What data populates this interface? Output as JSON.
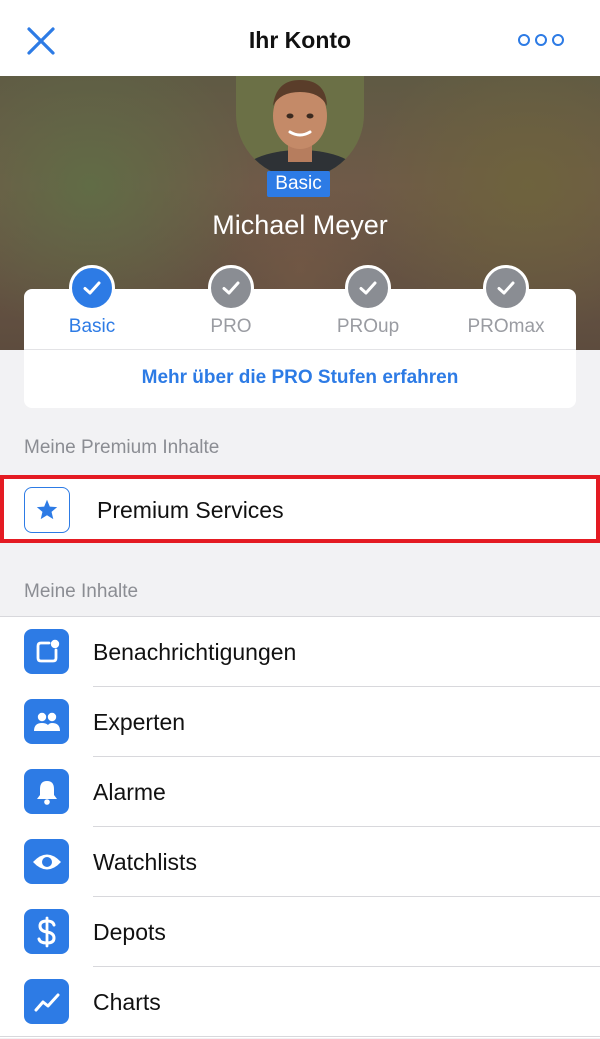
{
  "nav": {
    "title": "Ihr Konto",
    "close_icon": "close-icon",
    "more_icon": "more-icon"
  },
  "profile": {
    "badge": "Basic",
    "name": "Michael Meyer"
  },
  "tiers": {
    "items": [
      {
        "label": "Basic",
        "active": true
      },
      {
        "label": "PRO",
        "active": false
      },
      {
        "label": "PROup",
        "active": false
      },
      {
        "label": "PROmax",
        "active": false
      }
    ],
    "link": "Mehr über die PRO Stufen erfahren"
  },
  "premium": {
    "section_label": "Meine Premium Inhalte",
    "item": {
      "label": "Premium Services",
      "icon": "star-icon"
    }
  },
  "content": {
    "section_label": "Meine Inhalte",
    "items": [
      {
        "label": "Benachrichtigungen",
        "icon": "notification-icon"
      },
      {
        "label": "Experten",
        "icon": "people-icon"
      },
      {
        "label": "Alarme",
        "icon": "bell-icon"
      },
      {
        "label": "Watchlists",
        "icon": "eye-icon"
      },
      {
        "label": "Depots",
        "icon": "dollar-icon"
      },
      {
        "label": "Charts",
        "icon": "chart-icon"
      }
    ]
  },
  "colors": {
    "accent": "#2d7be5",
    "highlight": "#e41b23",
    "inactive": "#8a8d93"
  }
}
